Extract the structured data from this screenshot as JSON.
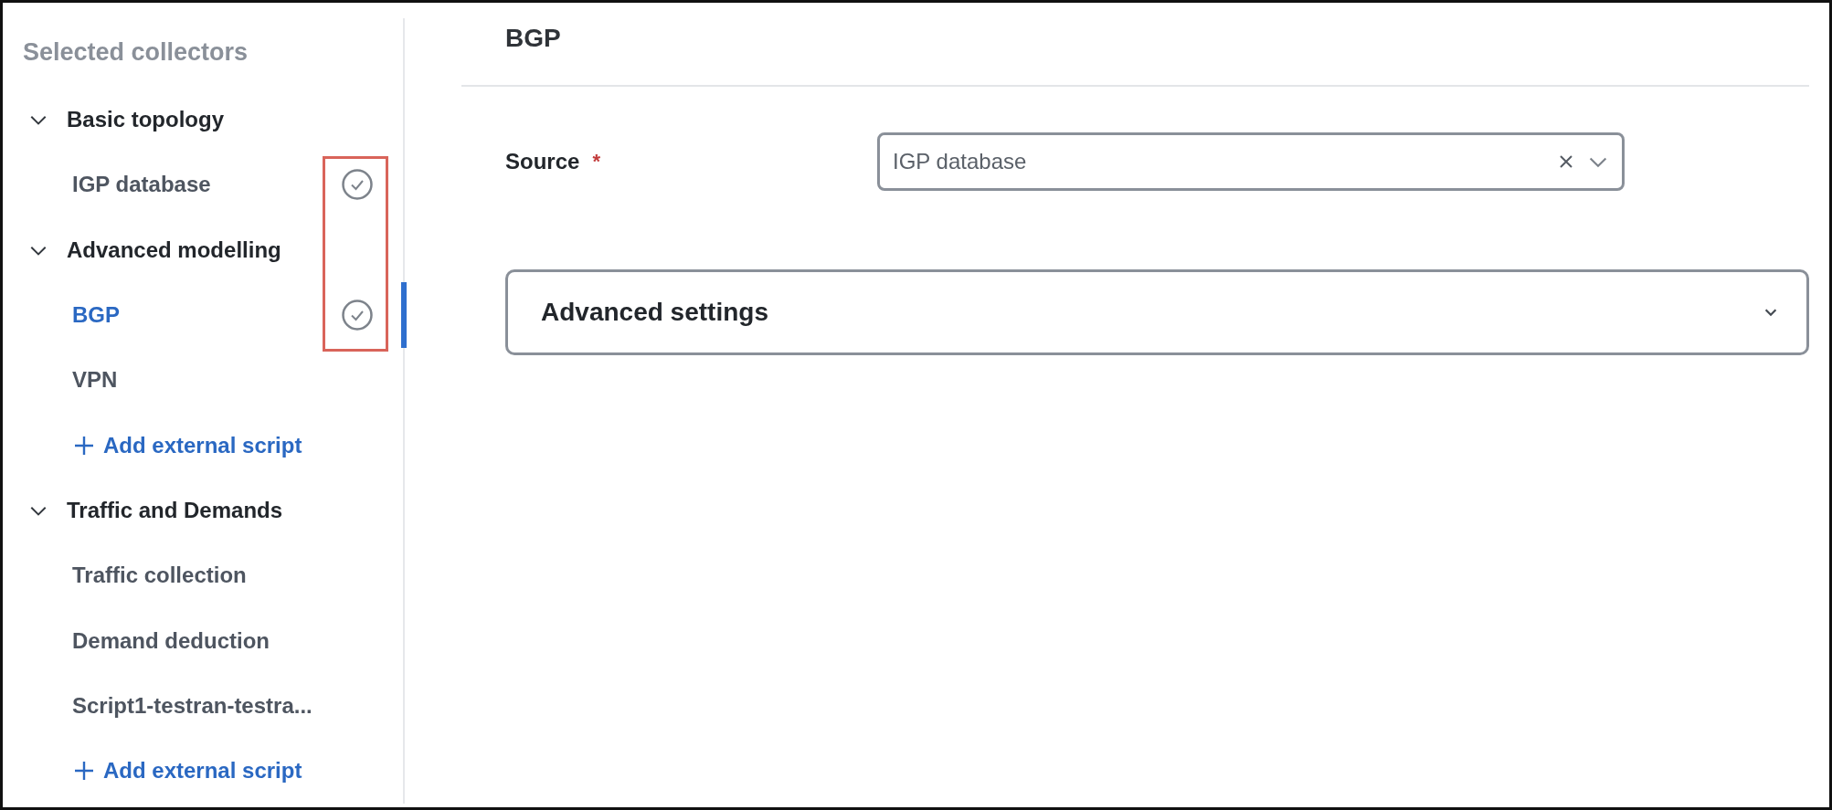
{
  "sidebar": {
    "title": "Selected collectors",
    "groups": [
      {
        "label": "Basic topology",
        "expanded": true,
        "items": [
          {
            "kind": "collector",
            "label": "IGP database",
            "selected": false,
            "done": true
          }
        ]
      },
      {
        "label": "Advanced modelling",
        "expanded": true,
        "items": [
          {
            "kind": "collector",
            "label": "BGP",
            "selected": true,
            "done": true
          },
          {
            "kind": "collector",
            "label": "VPN",
            "selected": false,
            "done": false
          },
          {
            "kind": "add",
            "label": "Add external script"
          }
        ]
      },
      {
        "label": "Traffic and Demands",
        "expanded": true,
        "items": [
          {
            "kind": "collector",
            "label": "Traffic collection",
            "selected": false,
            "done": false
          },
          {
            "kind": "collector",
            "label": "Demand deduction",
            "selected": false,
            "done": false
          },
          {
            "kind": "collector",
            "label": "Script1-testran-testra...",
            "selected": false,
            "done": false
          },
          {
            "kind": "add",
            "label": "Add external script"
          }
        ]
      }
    ]
  },
  "main": {
    "title": "BGP",
    "source": {
      "label": "Source",
      "required_mark": "*",
      "value": "IGP database"
    },
    "advanced": {
      "label": "Advanced settings",
      "expanded": false
    }
  }
}
